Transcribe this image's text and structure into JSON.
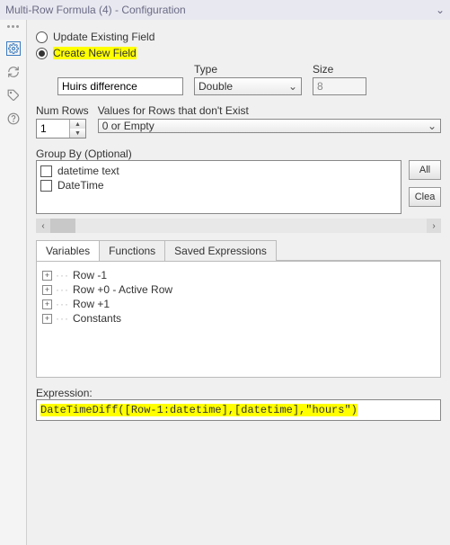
{
  "title": "Multi-Row Formula (4) - Configuration",
  "radios": {
    "update": "Update Existing Field",
    "create": "Create New  Field"
  },
  "fields": {
    "name_value": "Huirs difference",
    "type_label": "Type",
    "type_value": "Double",
    "size_label": "Size",
    "size_value": "8"
  },
  "numrows": {
    "label": "Num Rows",
    "value": "1",
    "values_label": "Values for Rows that don't Exist",
    "values_value": "0 or Empty"
  },
  "groupby": {
    "label": "Group By (Optional)",
    "items": [
      "datetime text",
      "DateTime"
    ],
    "btn_all": "All",
    "btn_clear": "Clea"
  },
  "tabs": {
    "variables": "Variables",
    "functions": "Functions",
    "saved": "Saved Expressions"
  },
  "tree": {
    "rowm1": "Row -1",
    "row0": "Row +0 - Active Row",
    "rowp1": "Row +1",
    "constants": "Constants"
  },
  "expression": {
    "label": "Expression:",
    "value": "DateTimeDiff([Row-1:datetime],[datetime],\"hours\")"
  }
}
